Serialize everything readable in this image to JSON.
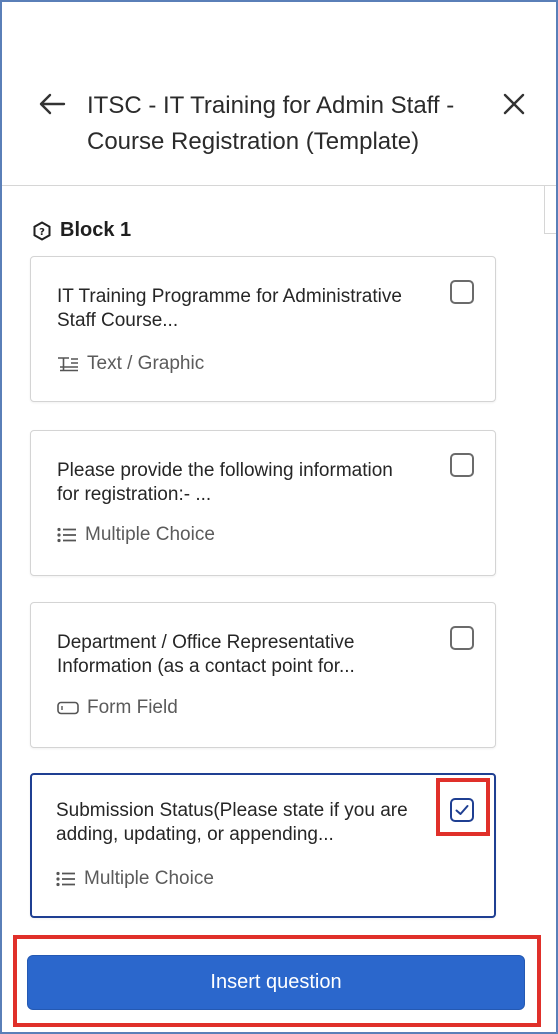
{
  "header": {
    "title": "ITSC - IT Training for Admin Staff - Course Registration (Template)",
    "back_icon": "arrow-left-icon",
    "close_icon": "close-icon"
  },
  "block": {
    "label": "Block 1",
    "icon": "question-hexagon-icon"
  },
  "questions": [
    {
      "text": "IT Training Programme for Administrative Staff Course...",
      "type_label": "Text / Graphic",
      "type_icon": "text-graphic-icon",
      "checked": false
    },
    {
      "text": "Please provide the following information for registration:- ...",
      "type_label": "Multiple Choice",
      "type_icon": "list-icon",
      "checked": false
    },
    {
      "text": "Department / Office Representative Information (as a contact point for...",
      "type_label": "Form Field",
      "type_icon": "form-field-icon",
      "checked": false
    },
    {
      "text": "Submission Status(Please state if you are adding, updating, or appending...",
      "type_label": "Multiple Choice",
      "type_icon": "list-icon",
      "checked": true
    }
  ],
  "footer": {
    "insert_label": "Insert question"
  },
  "colors": {
    "primary": "#2b67cc",
    "selected_border": "#1f3f92",
    "highlight": "#e0302a"
  }
}
